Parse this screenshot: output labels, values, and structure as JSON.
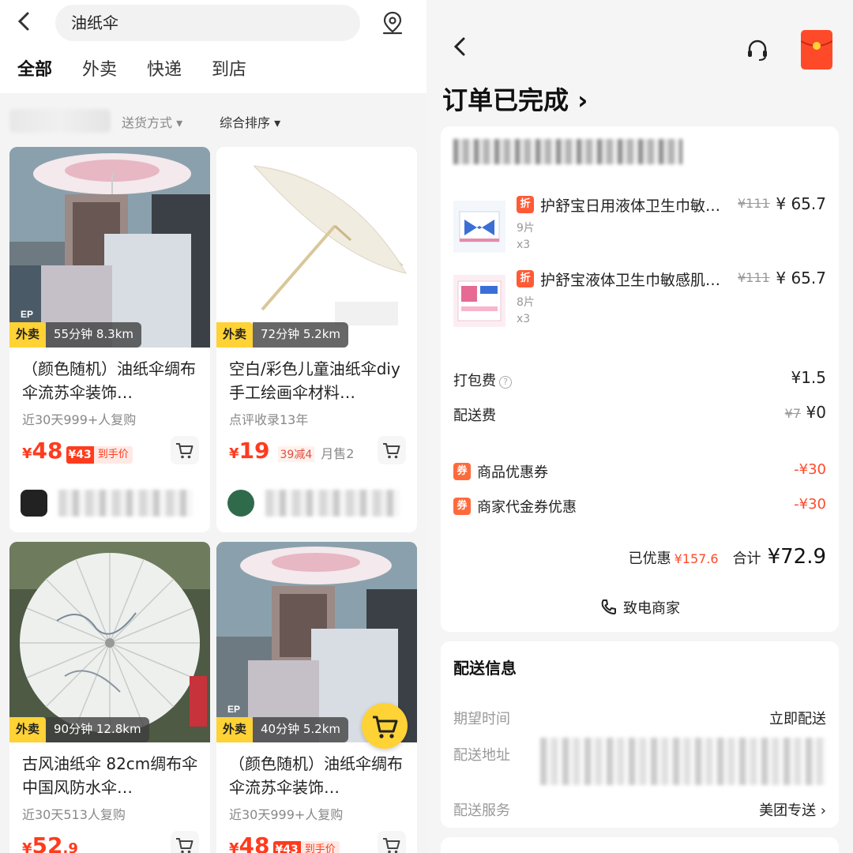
{
  "left": {
    "search": {
      "query": "油纸伞"
    },
    "tabs": [
      {
        "label": "全部"
      },
      {
        "label": "外卖"
      },
      {
        "label": "快递"
      },
      {
        "label": "到店"
      }
    ],
    "filters": {
      "delivery": "送货方式 ▾",
      "sort": "综合排序 ▾"
    },
    "products": [
      {
        "tag": "外卖",
        "eta": "55分钟 8.3km",
        "title": "（颜色随机）油纸伞绸布伞流苏伞装饰…",
        "sub": "近30天999+人复购",
        "price_int": "48",
        "price_dec": "",
        "coupon_badge": "¥43",
        "coupon_text": "到手价"
      },
      {
        "tag": "外卖",
        "eta": "72分钟 5.2km",
        "title": "空白/彩色儿童油纸伞diy手工绘画伞材料…",
        "sub": "点评收录13年",
        "price_int": "19",
        "price_dec": "",
        "strike": "39减4",
        "monthly": "月售2"
      },
      {
        "tag": "外卖",
        "eta": "90分钟 12.8km",
        "title": "古风油纸伞 82cm绸布伞 中国风防水伞…",
        "sub": "近30天513人复购",
        "price_int": "52",
        "price_dec": ".9"
      },
      {
        "tag": "外卖",
        "eta": "40分钟 5.2km",
        "title": "（颜色随机）油纸伞绸布伞流苏伞装饰…",
        "sub": "近30天999+人复购",
        "price_int": "48",
        "price_dec": "",
        "coupon_badge": "¥43",
        "coupon_text": "到手价"
      }
    ],
    "currency": "¥"
  },
  "right": {
    "title": "订单已完成 ›",
    "items": [
      {
        "badge": "折",
        "name": "护舒宝日用液体卫生巾敏…",
        "orig": "¥111",
        "price": "¥ 65.7",
        "spec": "9片",
        "qty": "x3"
      },
      {
        "badge": "折",
        "name": "护舒宝液体卫生巾敏感肌…",
        "orig": "¥111",
        "price": "¥ 65.7",
        "spec": "8片",
        "qty": "x3"
      }
    ],
    "fees": {
      "packing_label": "打包费",
      "packing_value": "¥1.5",
      "delivery_label": "配送费",
      "delivery_orig": "¥7",
      "delivery_value": "¥0"
    },
    "discounts": [
      {
        "badge": "券",
        "label": "商品优惠券",
        "value": "-¥30"
      },
      {
        "badge": "券",
        "label": "商家代金券优惠",
        "value": "-¥30"
      }
    ],
    "summary": {
      "saved_label": "已优惠",
      "saved_value": "¥157.6",
      "total_label": "合计",
      "total_value": "¥72.9"
    },
    "call_merchant": "致电商家",
    "delivery_info": {
      "title": "配送信息",
      "expected_label": "期望时间",
      "expected_value": "立即配送",
      "address_label": "配送地址",
      "service_label": "配送服务",
      "service_value": "美团专送 ›"
    },
    "colors": {
      "accent": "#ff4a2a",
      "brand_yellow": "#ffd235"
    }
  }
}
